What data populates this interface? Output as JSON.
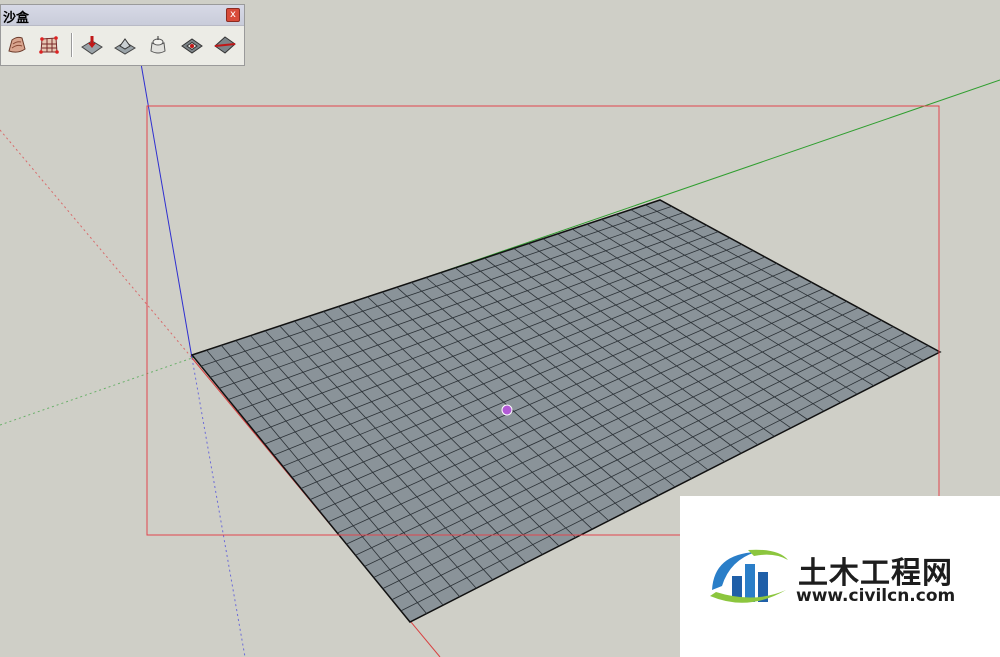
{
  "toolbar": {
    "title": "沙盒",
    "close_label": "x",
    "tools": [
      {
        "icon": "from-contours-icon"
      },
      {
        "icon": "from-scratch-icon"
      },
      {
        "icon": "smoove-icon"
      },
      {
        "icon": "stamp-icon"
      },
      {
        "icon": "drape-icon"
      },
      {
        "icon": "add-detail-icon"
      },
      {
        "icon": "flip-edge-icon"
      }
    ]
  },
  "viewport": {
    "background": "#cfcfc7",
    "grid_columns": 32,
    "grid_rows": 24,
    "selection_box_color": "#e0454d",
    "axis_colors": {
      "red": "#d84b4b",
      "green": "#3aa33a",
      "blue": "#3b3bc8"
    }
  },
  "watermark": {
    "title": "土木工程网",
    "url": "www.civilcn.com"
  }
}
